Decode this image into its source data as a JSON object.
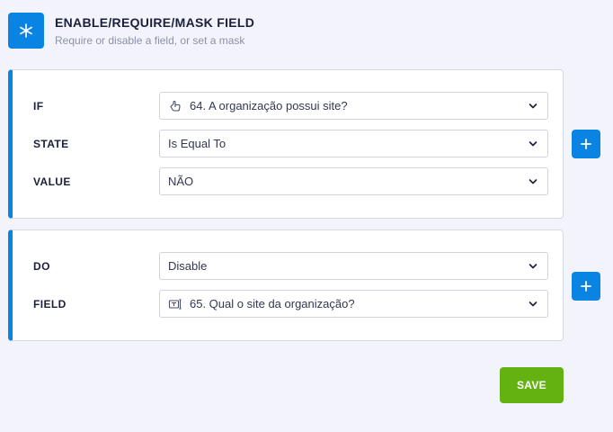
{
  "header": {
    "icon": "asterisk-icon",
    "title": "ENABLE/REQUIRE/MASK FIELD",
    "subtitle": "Require or disable a field, or set a mask"
  },
  "condition": {
    "if_label": "IF",
    "if_value": "64. A organização possui site?",
    "if_icon": "radio-field-icon",
    "state_label": "STATE",
    "state_value": "Is Equal To",
    "value_label": "VALUE",
    "value_value": "NÃO"
  },
  "action": {
    "do_label": "DO",
    "do_value": "Disable",
    "field_label": "FIELD",
    "field_value": "65. Qual o site da organização?",
    "field_icon": "text-field-icon"
  },
  "buttons": {
    "add_icon": "plus-icon",
    "save_label": "SAVE"
  },
  "colors": {
    "accent": "#0a84e3",
    "save": "#64b211",
    "background": "#f3f4fb"
  }
}
